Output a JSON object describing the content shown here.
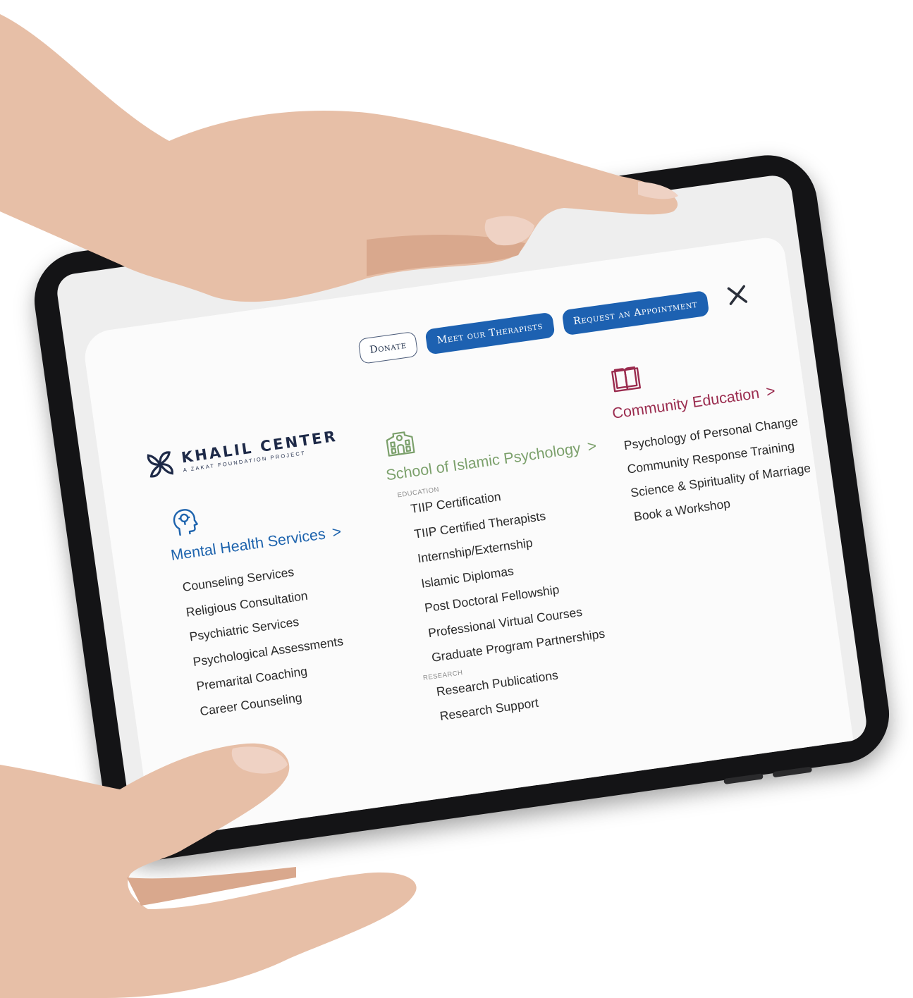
{
  "header": {
    "donate_label": "Donate",
    "therapists_label": "Meet our Therapists",
    "appointment_label": "Request an Appointment",
    "close_icon": "close-icon"
  },
  "logo": {
    "title": "KHALIL CENTER",
    "subtitle": "A ZAKAT FOUNDATION PROJECT"
  },
  "columns": {
    "mental_health": {
      "icon": "head-profile-icon",
      "title": "Mental Health Services",
      "chevron": ">",
      "items": [
        "Counseling Services",
        "Religious Consultation",
        "Psychiatric Services",
        "Psychological Assessments",
        "Premarital Coaching",
        "Career Counseling"
      ]
    },
    "school": {
      "icon": "school-building-icon",
      "title": "School of Islamic Psychology",
      "chevron": ">",
      "education_label": "EDUCATION",
      "education_items": [
        "TIIP Certification",
        "TIIP Certified Therapists",
        "Internship/Externship",
        "Islamic Diplomas",
        "Post Doctoral Fellowship",
        "Professional Virtual Courses",
        "Graduate Program Partnerships"
      ],
      "research_label": "RESEARCH",
      "research_items": [
        "Research Publications",
        "Research Support"
      ]
    },
    "community": {
      "icon": "open-book-icon",
      "title": "Community Education",
      "chevron": ">",
      "items": [
        "Psychology of Personal Change",
        "Community Response Training",
        "Science & Spirituality of Marriage",
        "Book a Workshop"
      ]
    }
  },
  "colors": {
    "primary_blue": "#1d61b1",
    "green": "#7ba06b",
    "maroon": "#9a2b4e",
    "navy": "#1e2a48"
  }
}
